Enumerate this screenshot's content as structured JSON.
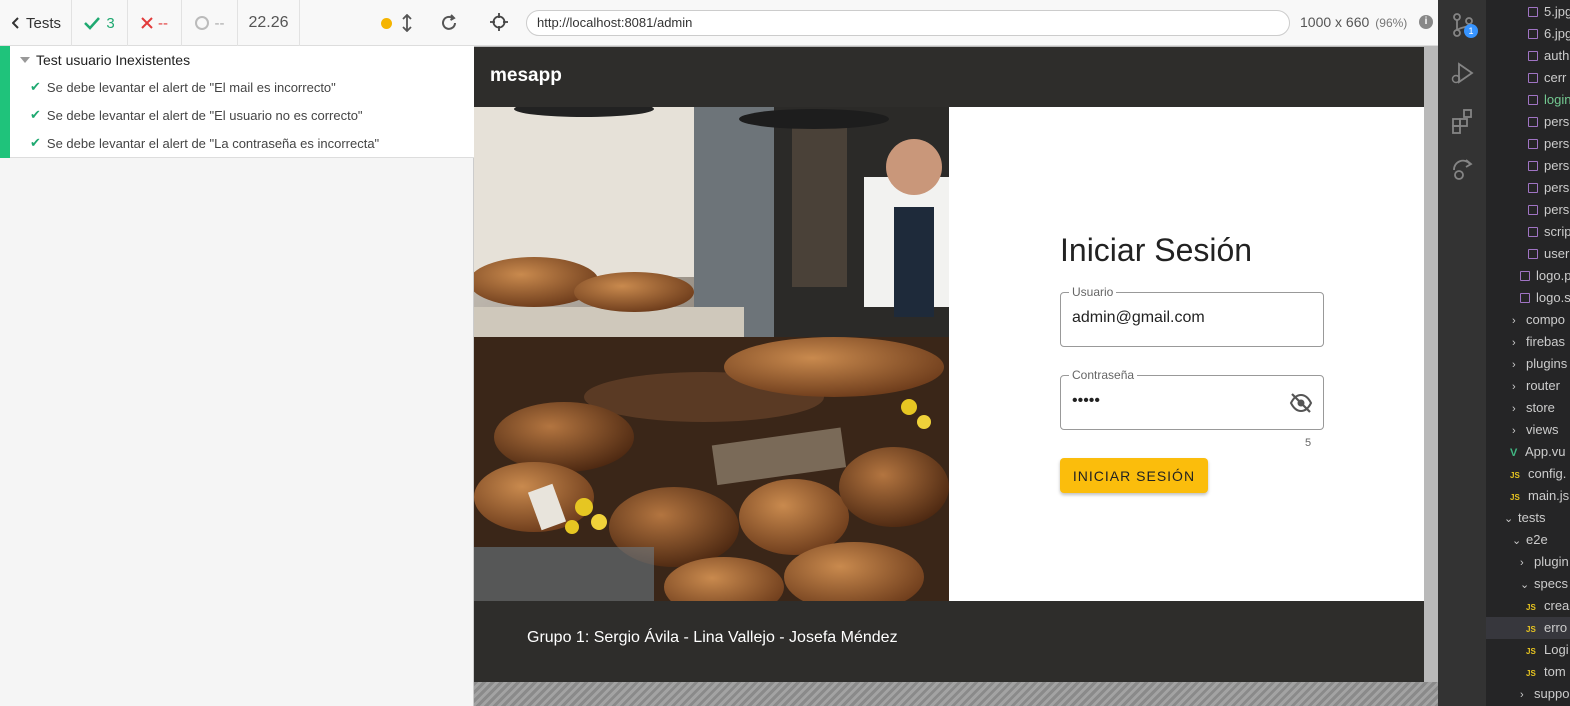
{
  "cypress": {
    "tests_label": "Tests",
    "passed": "3",
    "failed": "--",
    "pending": "--",
    "duration": "22.26",
    "suite_title": "Test usuario Inexistentes",
    "tests": [
      "Se debe levantar el alert de \"El mail es incorrecto\"",
      "Se debe levantar el alert de \"El usuario no es correcto\"",
      "Se debe levantar el alert de \"La contraseña es incorrecta\""
    ]
  },
  "browser": {
    "url": "http://localhost:8081/admin",
    "viewport": "1000 x 660",
    "zoom": "(96%)"
  },
  "app": {
    "brand": "mesapp",
    "form_title": "Iniciar Sesión",
    "user_label": "Usuario",
    "user_value": "admin@gmail.com",
    "password_label": "Contraseña",
    "password_value": "•••••",
    "password_length": "5",
    "login_button": "INICIAR SESIÓN",
    "footer": "Grupo 1: Sergio Ávila - Lina Vallejo - Josefa Méndez"
  },
  "vscode": {
    "scm_badge": "1",
    "files": [
      {
        "label": "5.jpg",
        "icon": "image"
      },
      {
        "label": "6.jpg",
        "icon": "image"
      },
      {
        "label": "auth",
        "icon": "image"
      },
      {
        "label": "cerr",
        "icon": "image"
      },
      {
        "label": "login",
        "icon": "image"
      },
      {
        "label": "pers",
        "icon": "image"
      },
      {
        "label": "pers",
        "icon": "image"
      },
      {
        "label": "pers",
        "icon": "image"
      },
      {
        "label": "pers",
        "icon": "image"
      },
      {
        "label": "pers",
        "icon": "image"
      },
      {
        "label": "scrip",
        "icon": "image"
      },
      {
        "label": "user",
        "icon": "image"
      },
      {
        "label": "logo.p",
        "icon": "image"
      },
      {
        "label": "logo.s",
        "icon": "image"
      },
      {
        "label": "compo",
        "icon": "folder"
      },
      {
        "label": "firebas",
        "icon": "folder"
      },
      {
        "label": "plugins",
        "icon": "folder"
      },
      {
        "label": "router",
        "icon": "folder"
      },
      {
        "label": "store",
        "icon": "folder"
      },
      {
        "label": "views",
        "icon": "folder"
      },
      {
        "label": "App.vu",
        "icon": "vue"
      },
      {
        "label": "config.",
        "icon": "js"
      },
      {
        "label": "main.js",
        "icon": "js"
      },
      {
        "label": "tests",
        "icon": "folder-open"
      },
      {
        "label": "e2e",
        "icon": "folder-open"
      },
      {
        "label": "plugin",
        "icon": "folder"
      },
      {
        "label": "specs",
        "icon": "folder-open"
      },
      {
        "label": "crea",
        "icon": "js"
      },
      {
        "label": "erro",
        "icon": "js"
      },
      {
        "label": "Logi",
        "icon": "js"
      },
      {
        "label": "tom",
        "icon": "js"
      },
      {
        "label": "suppo",
        "icon": "folder"
      }
    ]
  }
}
